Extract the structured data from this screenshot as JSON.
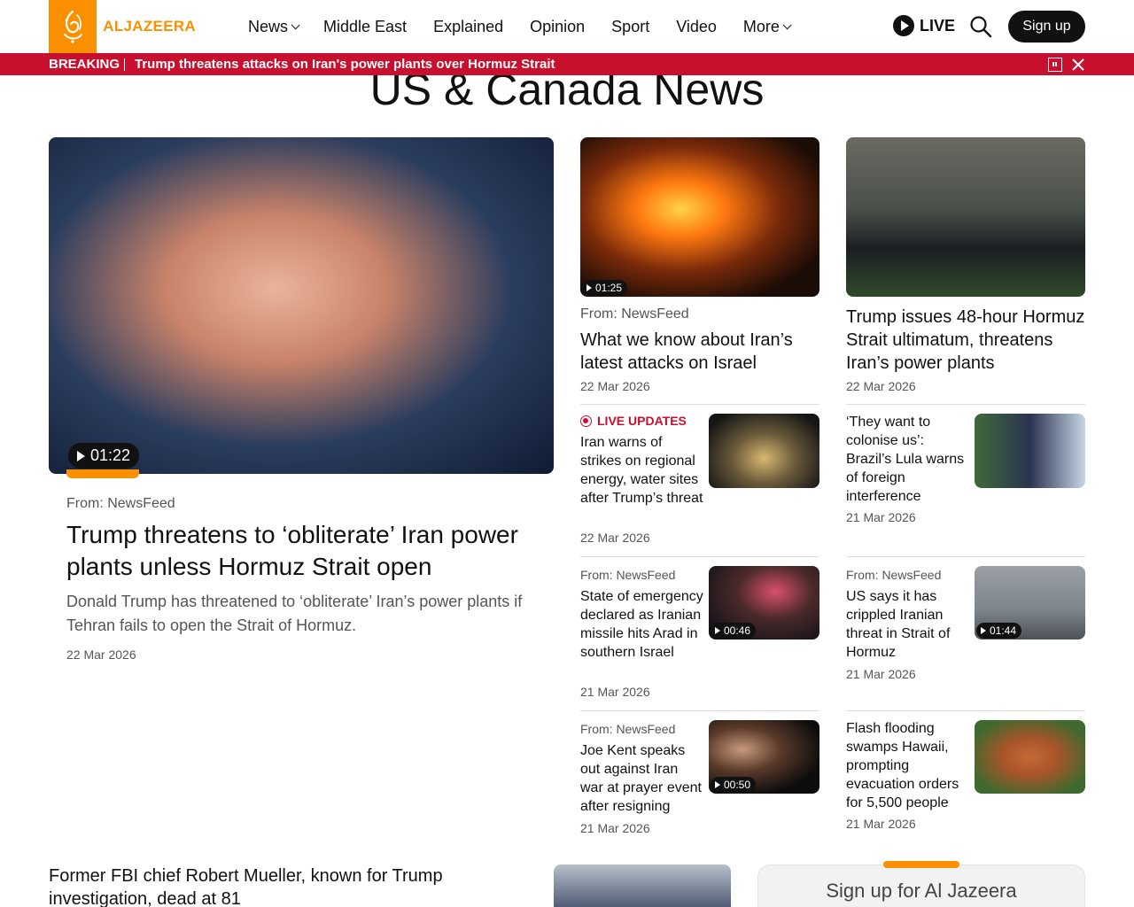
{
  "header": {
    "logo_text": "ALJAZEERA",
    "nav": [
      {
        "label": "News",
        "has_dropdown": true
      },
      {
        "label": "Middle East",
        "has_dropdown": false
      },
      {
        "label": "Explained",
        "has_dropdown": false
      },
      {
        "label": "Opinion",
        "has_dropdown": false
      },
      {
        "label": "Sport",
        "has_dropdown": false
      },
      {
        "label": "Video",
        "has_dropdown": false
      },
      {
        "label": "More",
        "has_dropdown": true
      }
    ],
    "live_label": "LIVE",
    "signup_label": "Sign up"
  },
  "breaking": {
    "tag": "BREAKING",
    "text": "Trump threatens attacks on Iran's power plants over Hormuz Strait"
  },
  "page_title": "US & Canada News",
  "hero": {
    "duration": "01:22",
    "source": "From: NewsFeed",
    "headline": "Trump threatens to ‘obliterate’ Iran power plants unless Hormuz Strait open",
    "summary": "Donald Trump has threatened to ‘obliterate’ Iran’s power plants if Tehran fails to open the Strait of Hormuz.",
    "date": "22 Mar 2026"
  },
  "mid_cards": [
    {
      "duration": "01:25",
      "source": "From: NewsFeed",
      "headline": "What we know about Iran’s latest attacks on Israel",
      "date": "22 Mar 2026"
    },
    {
      "source": "",
      "headline": "Trump issues 48-hour Hormuz Strait ultimatum, threatens Iran’s power plants",
      "date": "22 Mar 2026"
    }
  ],
  "small_cards": {
    "left": [
      {
        "live_label": "LIVE UPDATES",
        "headline": "Iran warns of strikes on regional energy, water sites after Trump’s threat",
        "date": "22 Mar 2026"
      },
      {
        "source": "From: NewsFeed",
        "headline": "State of emergency declared as Iranian missile hits Arad in southern Israel",
        "date": "21 Mar 2026",
        "duration": "00:46"
      },
      {
        "source": "From: NewsFeed",
        "headline": "Joe Kent speaks out against Iran war at prayer event after resigning",
        "date": "21 Mar 2026",
        "duration": "00:50"
      }
    ],
    "right": [
      {
        "headline": "‘They want to colonise us’: Brazil’s Lula warns of foreign interference",
        "date": "21 Mar 2026"
      },
      {
        "source": "From: NewsFeed",
        "headline": "US says it has crippled Iranian threat in Strait of Hormuz",
        "date": "21 Mar 2026",
        "duration": "01:44"
      },
      {
        "headline": "Flash flooding swamps Hawaii, prompting evacuation orders for 5,500 people",
        "date": "21 Mar 2026"
      }
    ]
  },
  "bottom": {
    "headline": "Former FBI chief Robert Mueller, known for Trump investigation, dead at 81",
    "newsletter_title": "Sign up for Al Jazeera"
  },
  "colors": {
    "brand": "#fa9000",
    "breaking": "#c8102e",
    "button": "#111111"
  }
}
